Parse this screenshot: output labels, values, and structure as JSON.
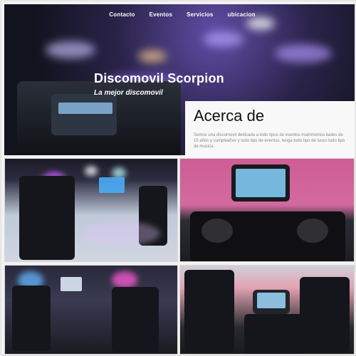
{
  "nav": {
    "items": [
      {
        "label": "Contacto"
      },
      {
        "label": "Eventos"
      },
      {
        "label": "Servicios"
      },
      {
        "label": "ubicacion"
      }
    ]
  },
  "hero": {
    "title": "Discomovil Scorpion",
    "subtitle": "La mejor discomovil"
  },
  "about": {
    "heading": "Acerca de",
    "text": "Somos una discomovil dedicada a todo tipos de eventos matrimonios bailes de 15 años y cumpleaños y todo tipo de eventos, tenga todo tipo de luces todo tipo de musica."
  }
}
